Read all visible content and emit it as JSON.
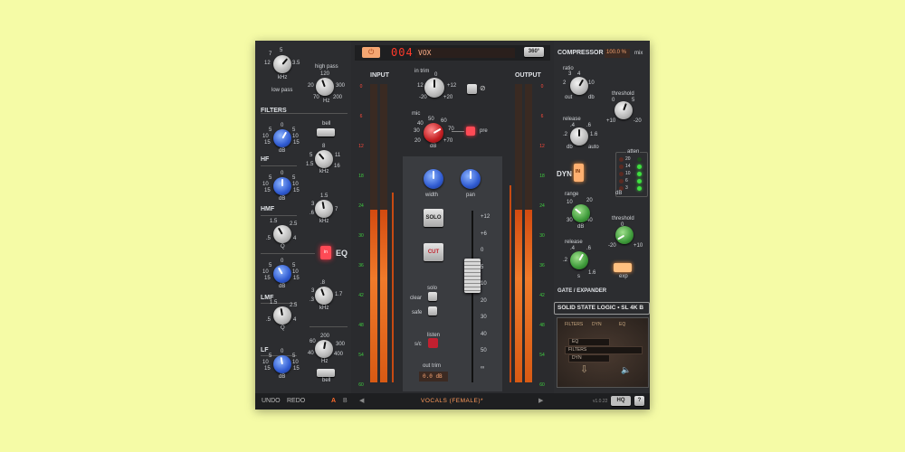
{
  "header": {
    "power_icon": "power-icon",
    "channel_number": "004",
    "channel_name": "VOX",
    "view_label": "360°"
  },
  "filters": {
    "lp_scale": [
      "5",
      "3.5",
      "12",
      "7"
    ],
    "lp_unit": "kHz",
    "lp_label": "low pass",
    "hp_label": "high pass",
    "hp_scale": [
      "120",
      "20",
      "300",
      "70",
      "200"
    ],
    "hp_unit": "Hz",
    "section_label": "FILTERS"
  },
  "eq": {
    "hf_label": "HF",
    "hmf_label": "HMF",
    "lmf_label": "LMF",
    "lf_label": "LF",
    "bell_label": "bell",
    "eq_label": "EQ",
    "eq_btn_label": "in",
    "gain_scale": [
      "0",
      "5",
      "5",
      "10",
      "10",
      "15",
      "15"
    ],
    "db_unit": "dB",
    "q_unit": "Q",
    "khz_unit": "kHz",
    "hz_unit": "Hz",
    "hf_freq_scale": [
      "8",
      "5",
      "11",
      "1.5",
      "16"
    ],
    "hmf_freq_scale": [
      "1.5",
      "3",
      "7",
      ".6"
    ],
    "lmf_freq_scale": [
      ".8",
      "3",
      ".3",
      "1.7"
    ],
    "lf_freq_scale": [
      "200",
      "60",
      "300",
      "40",
      "400"
    ],
    "hmf_q_scale": [
      "1.5",
      "2.5",
      ".5",
      "4"
    ],
    "lmf_q_scale": [
      "1.5",
      "2.5",
      ".5",
      "4"
    ]
  },
  "input": {
    "label": "INPUT",
    "scale": [
      "0",
      "6",
      "12",
      "18",
      "24",
      "30",
      "36",
      "42",
      "48",
      "54",
      "60"
    ],
    "level_l": 0.58,
    "level_r": 0.58
  },
  "output": {
    "label": "OUTPUT",
    "scale": [
      "0",
      "6",
      "12",
      "18",
      "24",
      "30",
      "36",
      "42",
      "48",
      "54",
      "60"
    ],
    "level_l": 0.58,
    "level_r": 0.58
  },
  "center": {
    "in_trim_label": "in trim",
    "in_trim_scale": [
      "0",
      "12",
      "+12",
      "-20",
      "+20"
    ],
    "phase_icon": "phase-icon",
    "mic_label": "mic",
    "mic_scale": [
      "50",
      "60",
      "40",
      "70",
      "30",
      "20",
      "+70",
      "dB"
    ],
    "pre_label": "pre",
    "width_label": "width",
    "pan_label": "pan",
    "solo_label": "SOLO",
    "cut_label": "CUT",
    "solo_small": "solo",
    "clear_label": "clear",
    "safe_label": "safe",
    "listen_label": "listen",
    "sc_label": "s/c",
    "out_trim_label": "out trim",
    "out_trim_value": "0.0 dB",
    "fader_scale": [
      "+12",
      "+6",
      "0",
      "5",
      "10",
      "20",
      "30",
      "40",
      "50",
      "∞"
    ]
  },
  "compressor": {
    "label": "COMPRESSOR",
    "mix_value": "100.0 %",
    "mix_label": "mix",
    "ratio_label": "ratio",
    "ratio_scale": [
      "3",
      "4",
      "2",
      "10",
      "out",
      "db"
    ],
    "threshold_label": "threshold",
    "threshold_scale": [
      "0",
      "5",
      "+10",
      "-20"
    ],
    "release_label": "release",
    "release_scale": [
      ".4",
      ".6",
      ".2",
      "1.6",
      "db",
      "auto"
    ],
    "dyn_label": "DYN",
    "dyn_btn": "IN",
    "atten_label": "atten",
    "atten_scale": [
      "20",
      "14",
      "10",
      "6",
      "3"
    ],
    "atten_unit": "dB"
  },
  "gate": {
    "range_label": "range",
    "range_scale": [
      "10",
      "20",
      "30",
      "40",
      "dB"
    ],
    "threshold_label": "threshold",
    "threshold_scale": [
      "0",
      "-20",
      "+10"
    ],
    "release_label": "release",
    "release_scale": [
      ".4",
      ".6",
      ".2",
      "1.6",
      "s"
    ],
    "exp_label": "exp",
    "section_label": "GATE / EXPANDER"
  },
  "brand": "SOLID STATE LOGIC • SL 4K B",
  "routing": {
    "tabs": [
      "FILTERS",
      "DYN",
      "EQ"
    ],
    "items": [
      "EQ",
      "FILTERS",
      "DYN"
    ]
  },
  "footer": {
    "undo": "UNDO",
    "redo": "REDO",
    "a": "A",
    "b": "B",
    "preset": "VOCALS (FEMALE)*",
    "version": "v1.0.22",
    "hq": "HQ",
    "help": "?"
  },
  "colors": {
    "background": "#f5fba6",
    "panel": "#2a2b2e",
    "accent_orange": "#f07a2a",
    "red_button": "#e0303a",
    "green_led": "#3fe040"
  }
}
